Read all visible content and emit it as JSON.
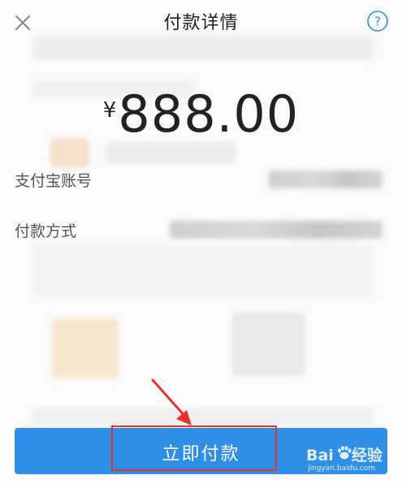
{
  "header": {
    "title": "付款详情"
  },
  "payment": {
    "currency": "¥",
    "amount": "888.00"
  },
  "details": [
    {
      "label": "支付宝账号"
    },
    {
      "label": "付款方式"
    }
  ],
  "actions": {
    "pay_label": "立即付款"
  },
  "watermark": {
    "main_left": "Bai",
    "main_right": "经验",
    "sub": "jingyan.baidu.com"
  },
  "colors": {
    "primary_button": "#2f8ee5",
    "help_icon": "#2f8ee5",
    "annotation": "#e8322e"
  },
  "icons": {
    "close": "close-icon",
    "help": "question-circle-icon",
    "arrow": "annotation-arrow-icon",
    "watermark": "baidu-paw-icon"
  }
}
